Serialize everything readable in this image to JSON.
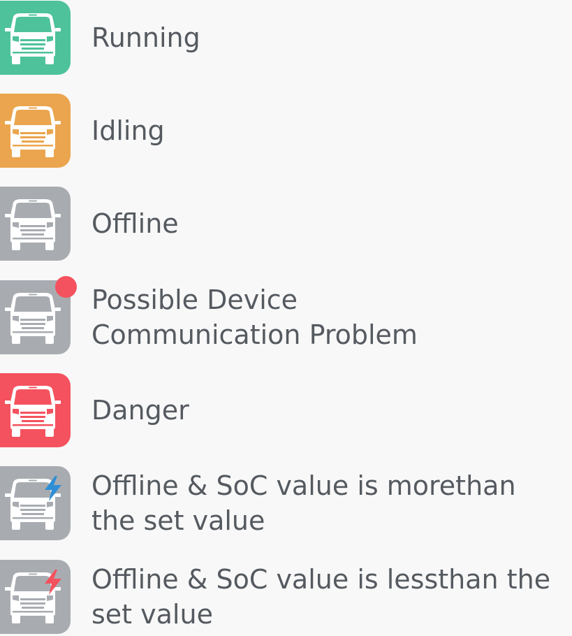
{
  "colors": {
    "running": "#4dc29b",
    "idling": "#eba54e",
    "offline": "#a8acb1",
    "danger": "#f4525e",
    "alert_dot": "#f4525e",
    "bolt_blue": "#2f8fd6",
    "bolt_red": "#f4525e",
    "van": "#ffffff",
    "text": "#555a60"
  },
  "legend": {
    "items": [
      {
        "icon": "van-icon",
        "color": "running",
        "badge": "",
        "lines": [
          "Running"
        ]
      },
      {
        "icon": "van-icon",
        "color": "idling",
        "badge": "",
        "lines": [
          "Idling"
        ]
      },
      {
        "icon": "van-icon",
        "color": "offline",
        "badge": "",
        "lines": [
          "Offline"
        ]
      },
      {
        "icon": "van-icon",
        "color": "offline",
        "badge": "alert-dot",
        "lines": [
          "Possible Device",
          "Communication Problem"
        ]
      },
      {
        "icon": "van-icon",
        "color": "danger",
        "badge": "",
        "lines": [
          "Danger"
        ]
      },
      {
        "icon": "van-icon",
        "color": "offline",
        "badge": "lightning-bolt-icon",
        "badge_color": "bolt_blue",
        "lines": [
          "Offline & SoC value is morethan",
          "the set value"
        ]
      },
      {
        "icon": "van-icon",
        "color": "offline",
        "badge": "lightning-bolt-icon",
        "badge_color": "bolt_red",
        "lines": [
          "Offline & SoC value is lessthan the",
          "set value"
        ]
      }
    ]
  }
}
